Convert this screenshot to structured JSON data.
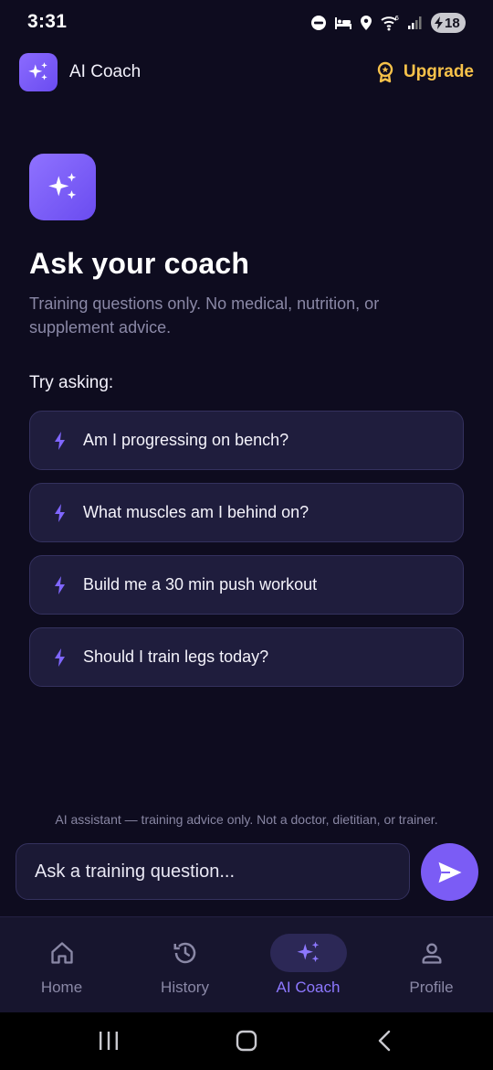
{
  "status_bar": {
    "time": "3:31",
    "battery_level": "18",
    "icons": [
      "do-not-disturb-icon",
      "bed-icon",
      "location-icon",
      "wifi-icon",
      "signal-icon",
      "battery-charging-icon"
    ]
  },
  "header": {
    "app_title": "AI Coach",
    "upgrade_label": "Upgrade"
  },
  "hero": {
    "title": "Ask your coach",
    "subtitle": "Training questions only. No medical, nutrition, or supplement advice."
  },
  "suggestions": {
    "label": "Try asking:",
    "items": [
      "Am I progressing on bench?",
      "What muscles am I behind on?",
      "Build me a 30 min push workout",
      "Should I train legs today?"
    ]
  },
  "composer": {
    "disclaimer": "AI assistant — training advice only. Not a doctor, dietitian, or trainer.",
    "placeholder": "Ask a training question..."
  },
  "bottom_nav": {
    "items": [
      {
        "label": "Home",
        "icon": "home-icon",
        "active": false
      },
      {
        "label": "History",
        "icon": "history-icon",
        "active": false
      },
      {
        "label": "AI Coach",
        "icon": "sparkles-icon",
        "active": true
      },
      {
        "label": "Profile",
        "icon": "person-icon",
        "active": false
      }
    ]
  },
  "colors": {
    "background": "#0e0c1f",
    "accent": "#7b5cf5",
    "active_nav": "#8d78ff",
    "upgrade": "#f7c24a",
    "card": "#1f1d3d"
  }
}
